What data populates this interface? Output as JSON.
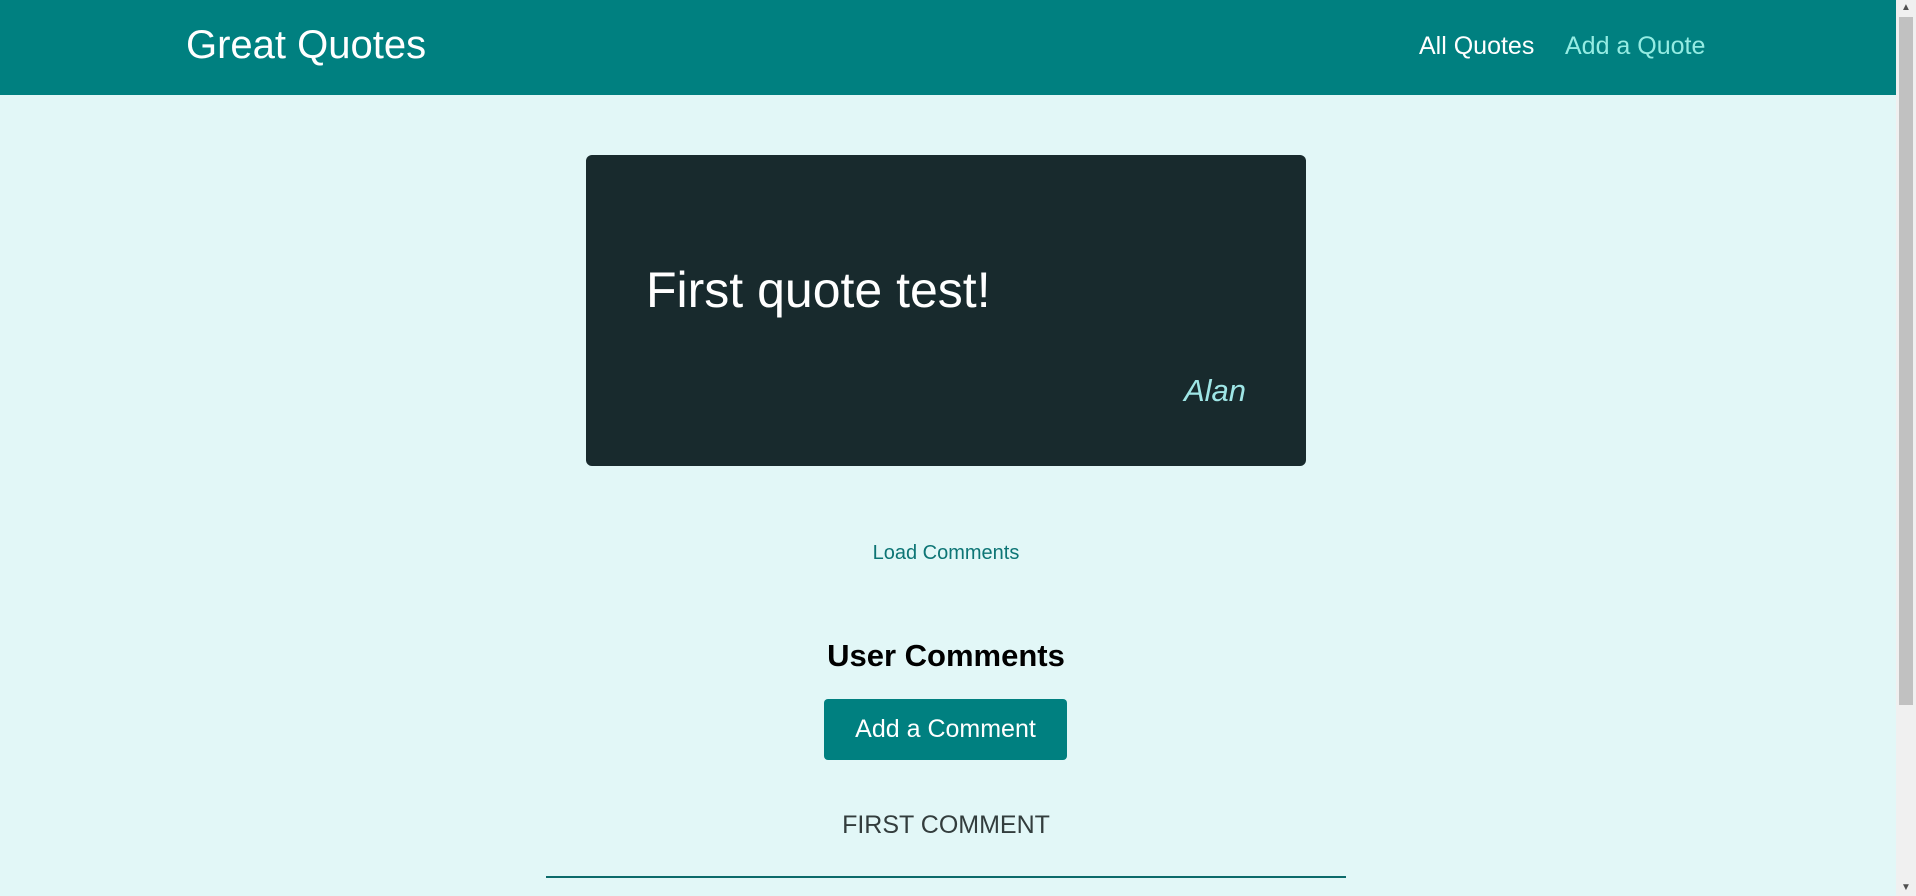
{
  "header": {
    "logo": "Great Quotes",
    "nav": {
      "all_quotes": "All Quotes",
      "add_quote": "Add a Quote"
    }
  },
  "quote": {
    "text": "First quote test!",
    "author": "Alan"
  },
  "comments": {
    "load_label": "Load Comments",
    "title": "User Comments",
    "add_button": "Add a Comment",
    "items": [
      {
        "text": "FIRST COMMENT"
      }
    ]
  },
  "scrollbar": {
    "up_icon": "▲",
    "down_icon": "▼"
  },
  "colors": {
    "header_bg": "#008080",
    "page_bg": "#e2f7f7",
    "card_bg": "#182a2d",
    "author_color": "#9fe6e6",
    "active_nav": "#95ece3"
  }
}
